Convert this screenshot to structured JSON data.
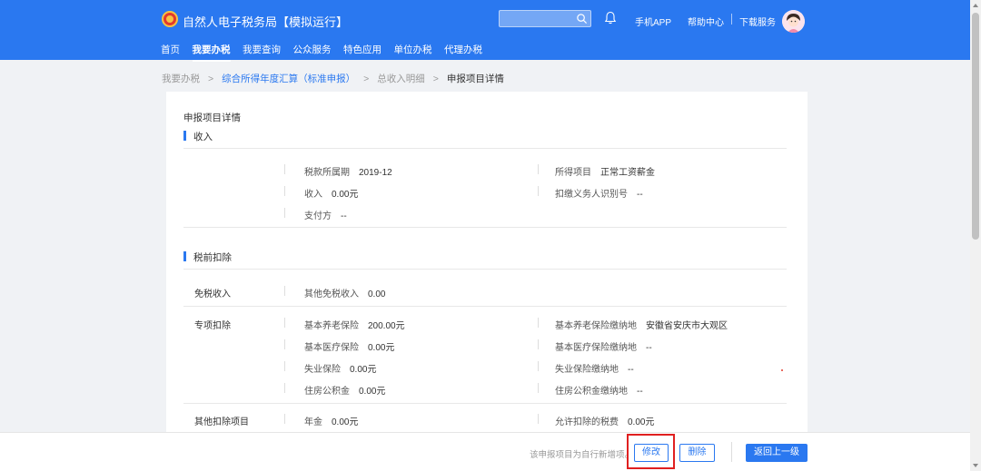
{
  "header": {
    "brand": "自然人电子税务局【模拟运行】",
    "search_placeholder": "",
    "links": {
      "app": "手机APP",
      "help": "帮助中心",
      "download": "下载服务"
    }
  },
  "nav": [
    "首页",
    "我要办税",
    "我要查询",
    "公众服务",
    "特色应用",
    "单位办税",
    "代理办税"
  ],
  "breadcrumb": {
    "items": [
      "我要办税",
      "综合所得年度汇算（标准申报）",
      "总收入明细"
    ],
    "current": "申报项目详情"
  },
  "card": {
    "title": "申报项目详情",
    "income": {
      "heading": "收入",
      "tax_period_label": "税款所属期",
      "tax_period": "2019-12",
      "income_item_label": "所得项目",
      "income_item": "正常工资薪金",
      "income_label": "收入",
      "income": "0.00元",
      "withholder_id_label": "扣缴义务人识别号",
      "withholder_id": "--",
      "payer_label": "支付方",
      "payer": "--"
    },
    "deductions": {
      "heading": "税前扣除",
      "tax_free": {
        "title": "免税收入",
        "other_label": "其他免税收入",
        "other": "0.00"
      },
      "special": {
        "title": "专项扣除",
        "pension_label": "基本养老保险",
        "pension": "200.00元",
        "pension_place_label": "基本养老保险缴纳地",
        "pension_place": "安徽省安庆市大观区",
        "medical_label": "基本医疗保险",
        "medical": "0.00元",
        "medical_place_label": "基本医疗保险缴纳地",
        "medical_place": "--",
        "unemployment_label": "失业保险",
        "unemployment": "0.00元",
        "unemployment_place_label": "失业保险缴纳地",
        "unemployment_place": "--",
        "housing_label": "住房公积金",
        "housing": "0.00元",
        "housing_place_label": "住房公积金缴纳地",
        "housing_place": "--"
      },
      "other": {
        "title": "其他扣除项目",
        "annuity_label": "年金",
        "annuity": "0.00元",
        "allowed_tax_label": "允许扣除的税费",
        "allowed_tax": "0.00元"
      }
    }
  },
  "footer": {
    "note": "该申报项目为自行新增项。",
    "modify": "修改",
    "delete": "删除",
    "back": "返回上一级"
  },
  "colors": {
    "primary": "#2a78f0",
    "highlight_box": "#e02020"
  }
}
